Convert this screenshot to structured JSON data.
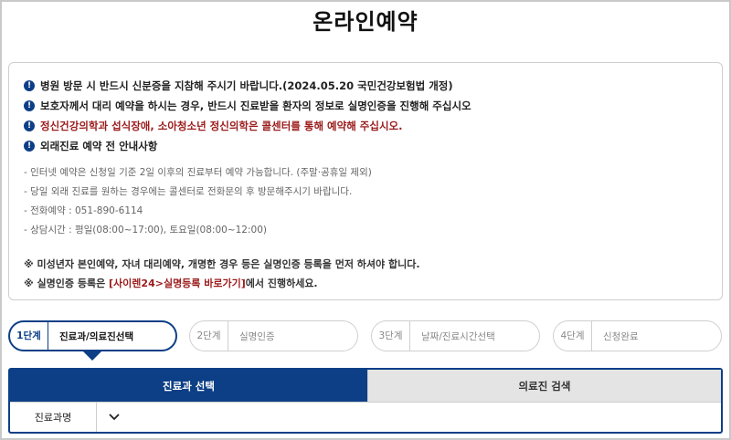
{
  "page": {
    "title": "온라인예약"
  },
  "notice": {
    "alerts": [
      {
        "text": "병원 방문 시 반드시 신분증을 지참해 주시기 바랍니다.(2024.05.20 국민건강보험법 개정)"
      },
      {
        "text": "보호자께서 대리 예약을 하시는 경우, 반드시 진료받을 환자의 정보로 실명인증을 진행해 주십시오"
      },
      {
        "text": "정신건강의학과 섭식장애, 소아청소년 정신의학은 콜센터를 통해 예약해 주십시오."
      },
      {
        "text": "외래진료 예약 전 안내사항"
      }
    ],
    "info": [
      "- 인터넷 예약은 신청일 기준 2일 이후의 진료부터 예약 가능합니다. (주말·공휴일 제외)",
      "- 당일 외래 진료를 원하는 경우에는 콜센터로 전화문의 후 방문해주시기 바랍니다.",
      "- 전화예약 : 051-890-6114",
      "- 상담시간 : 평일(08:00~17:00), 토요일(08:00~12:00)"
    ],
    "notes": {
      "line1": "※ 미성년자 본인예약, 자녀 대리예약, 개명한 경우 등은 실명인증 등록을 먼저 하셔야 합니다.",
      "line2_prefix": "※ 실명인증 등록은 ",
      "line2_link": "[사이렌24>실명등록 바로가기]",
      "line2_suffix": "에서 진행하세요."
    }
  },
  "steps": [
    {
      "num": "1단계",
      "label": "진료과/의료진선택"
    },
    {
      "num": "2단계",
      "label": "실명인증"
    },
    {
      "num": "3단계",
      "label": "날짜/진료시간선택"
    },
    {
      "num": "4단계",
      "label": "신청완료"
    }
  ],
  "tabs": {
    "department": "진료과 선택",
    "doctor": "의료진 검색"
  },
  "filter": {
    "label": "진료과명"
  },
  "colors": {
    "primary": "#0d3f86",
    "alert_red": "#9b1b1b"
  }
}
